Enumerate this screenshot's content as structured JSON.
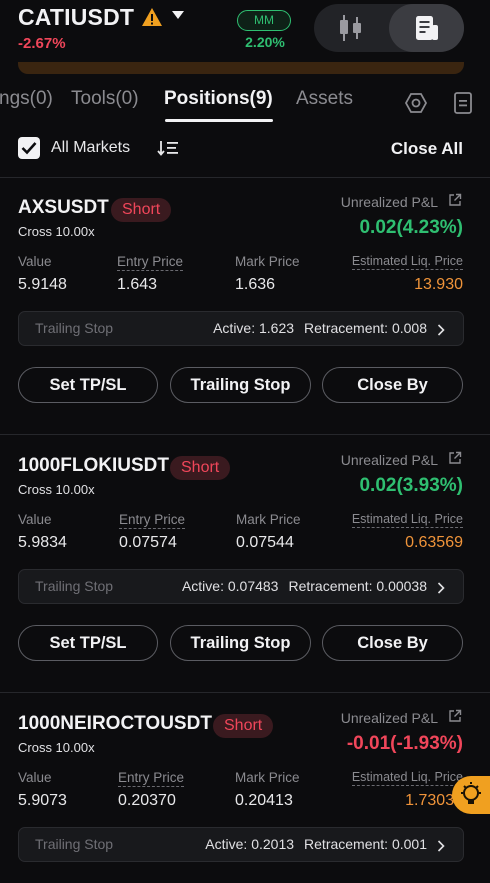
{
  "header": {
    "symbol": "CATIUSDT",
    "change": "-2.67%",
    "mm_label": "MM",
    "mm_value": "2.20%",
    "icons": [
      "warning-icon",
      "caret-down-icon",
      "candlestick-icon",
      "order-book-icon"
    ]
  },
  "tabs": [
    {
      "label": "ngs(0)"
    },
    {
      "label": "Tools(0)"
    },
    {
      "label": "Positions(9)"
    },
    {
      "label": "Assets"
    }
  ],
  "filter": {
    "all_markets_label": "All Markets",
    "close_all_label": "Close All"
  },
  "labels": {
    "upnl": "Unrealized P&L",
    "value": "Value",
    "entry": "Entry Price",
    "mark": "Mark Price",
    "liq": "Estimated Liq. Price",
    "trailing_stop": "Trailing Stop",
    "set_tpsl": "Set TP/SL",
    "trailing_stop_btn": "Trailing Stop",
    "close_by": "Close By"
  },
  "positions": [
    {
      "symbol": "AXSUSDT",
      "side": "Short",
      "leverage": "Cross 10.00x",
      "upnl": "0.02(4.23%)",
      "value": "5.9148",
      "entry": "1.643",
      "mark": "1.636",
      "liq": "13.930",
      "active": "Active: 1.623",
      "retracement": "Retracement: 0.008"
    },
    {
      "symbol": "1000FLOKIUSDT",
      "side": "Short",
      "leverage": "Cross 10.00x",
      "upnl": "0.02(3.93%)",
      "value": "5.9834",
      "entry": "0.07574",
      "mark": "0.07544",
      "liq": "0.63569",
      "active": "Active: 0.07483",
      "retracement": "Retracement: 0.00038"
    },
    {
      "symbol": "1000NEIROCTOUSDT",
      "side": "Short",
      "leverage": "Cross 10.00x",
      "upnl": "-0.01(-1.93%)",
      "value": "5.9073",
      "entry": "0.20370",
      "mark": "0.20413",
      "liq": "1.73030",
      "active": "Active: 0.2013",
      "retracement": "Retracement: 0.001"
    }
  ],
  "colors": {
    "positive": "#2fbf71",
    "negative": "#f0465a",
    "liquidation": "#f0943a",
    "floating_button": "#f0a020"
  }
}
